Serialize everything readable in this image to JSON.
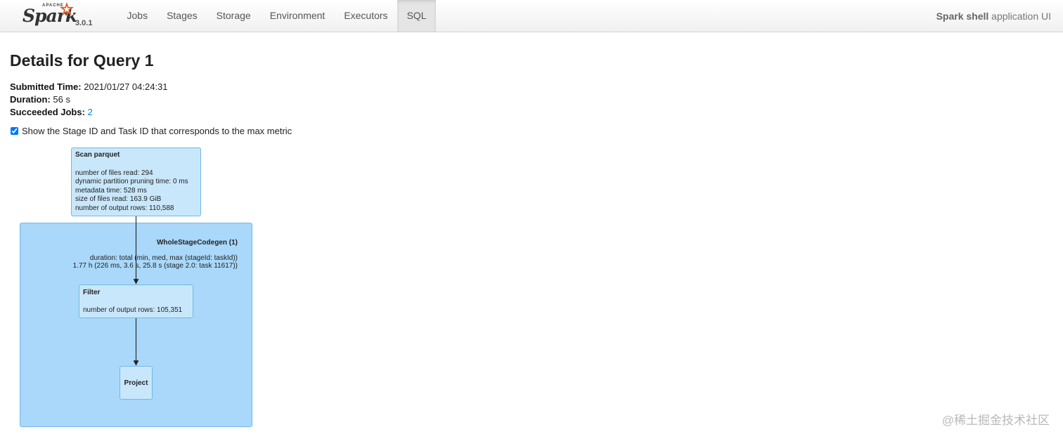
{
  "brand": {
    "apache": "APACHE",
    "name": "Spark",
    "version": "3.0.1"
  },
  "nav": {
    "items": [
      "Jobs",
      "Stages",
      "Storage",
      "Environment",
      "Executors",
      "SQL"
    ],
    "active": "SQL"
  },
  "app": {
    "name": "Spark shell",
    "suffix": " application UI"
  },
  "page": {
    "title": "Details for Query 1",
    "submitted_label": "Submitted Time:",
    "submitted_value": "2021/01/27 04:24:31",
    "duration_label": "Duration:",
    "duration_value": "56 s",
    "jobs_label": "Succeeded Jobs:",
    "jobs_value": "2"
  },
  "checkbox": {
    "checked": true,
    "label": "Show the Stage ID and Task ID that corresponds to the max metric"
  },
  "plan": {
    "scan": {
      "title": "Scan parquet",
      "metrics": [
        "number of files read: 294",
        "dynamic partition pruning time: 0 ms",
        "metadata time: 528 ms",
        "size of files read: 163.9 GiB",
        "number of output rows: 110,588"
      ]
    },
    "codegen": {
      "title": "WholeStageCodegen (1)",
      "line1": "duration: total (min, med, max (stageId: taskId))",
      "line2": "1.77 h (226 ms, 3.6 s, 25.8 s (stage 2.0: task 11617))"
    },
    "filter": {
      "title": "Filter",
      "metric": "number of output rows: 105,351"
    },
    "project": {
      "title": "Project"
    },
    "colors": {
      "node_fill": "#c9e7fb",
      "cluster_fill": "#a9d8fa",
      "border": "#6fb9e8"
    }
  },
  "watermark": "@稀土掘金技术社区"
}
